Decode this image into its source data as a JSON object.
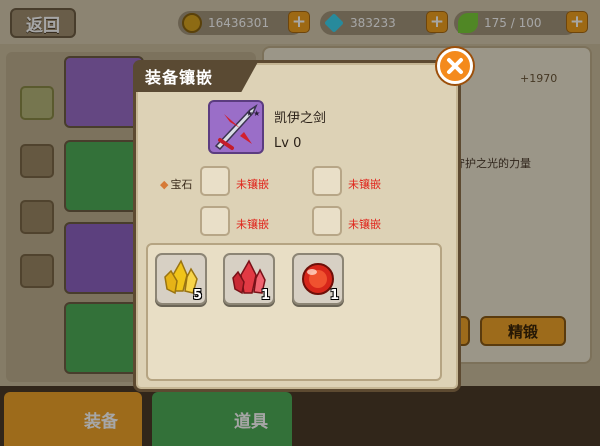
{
  "topbar": {
    "back_label": "返回",
    "gold": "16436301",
    "diamonds": "383233",
    "stamina": "175 / 100",
    "colors": {
      "gold": "#d9a520",
      "diamond": "#3dd4f0",
      "stamina": "#7ccf3a"
    }
  },
  "background": {
    "stat_bonus": "+1970",
    "desc_fragment": "守护之光的力量",
    "enhance_button": "精锻"
  },
  "bottom_tabs": [
    {
      "label": "装备",
      "icon": "armor-icon"
    },
    {
      "label": "道具",
      "icon": "bag-icon"
    }
  ],
  "dialog": {
    "title": "装备镶嵌",
    "item": {
      "name": "凯伊之剑",
      "level": "Lv 0",
      "icon": "sword-icon",
      "rarity_color": "#9a6ec8"
    },
    "gem_label": "宝石",
    "sockets": [
      {
        "status": "未镶嵌"
      },
      {
        "status": "未镶嵌"
      },
      {
        "status": "未镶嵌"
      },
      {
        "status": "未镶嵌"
      }
    ],
    "inventory": [
      {
        "name": "yellow-crystal-icon",
        "count": "5",
        "color": "#f0c419"
      },
      {
        "name": "red-crystal-icon",
        "count": "1",
        "color": "#e23a44"
      },
      {
        "name": "red-orb-icon",
        "count": "1",
        "color": "#d7261a"
      }
    ]
  }
}
